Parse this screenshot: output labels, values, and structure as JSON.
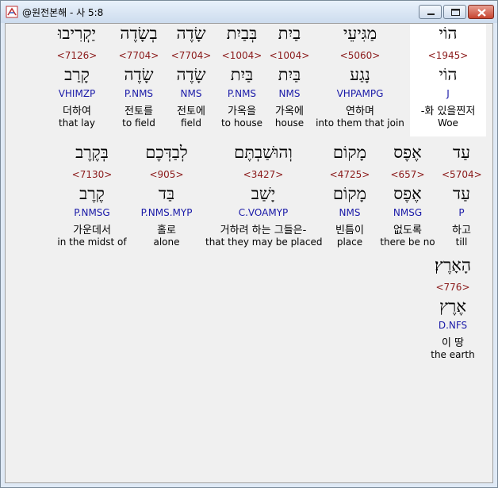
{
  "window": {
    "title": "@원전본해 - 사 5:8"
  },
  "words": [
    {
      "heb": "הוֹי",
      "strong": "<1945>",
      "lemma": "הוֹי",
      "parse": "J",
      "kor": "-화 있을찐저",
      "eng": "Woe",
      "highlight": true
    },
    {
      "heb": "מַגִּיעֵי",
      "strong": "<5060>",
      "lemma": "נָגַע",
      "parse": "VHPAMPG",
      "kor": "연하며",
      "eng": "into them that join"
    },
    {
      "heb": "בַיִת",
      "strong": "<1004>",
      "lemma": "בַּיִת",
      "parse": "NMS",
      "kor": "가옥에",
      "eng": "house"
    },
    {
      "heb": "בְּבַיִת",
      "strong": "<1004>",
      "lemma": "בַּיִת",
      "parse": "P.NMS",
      "kor": "가옥을",
      "eng": "to house"
    },
    {
      "heb": "שָׂדֶה",
      "strong": "<7704>",
      "lemma": "שָׂדֶה",
      "parse": "NMS",
      "kor": "전토에",
      "eng": "field"
    },
    {
      "heb": "בְשָׂדֶה",
      "strong": "<7704>",
      "lemma": "שָׂדֶה",
      "parse": "P.NMS",
      "kor": "전토를",
      "eng": "to field"
    },
    {
      "heb": "יַקְרִיבוּ",
      "strong": "<7126>",
      "lemma": "קָרַב",
      "parse": "VHIMZP",
      "kor": "더하여",
      "eng": "that lay"
    },
    {
      "heb": "עַד",
      "strong": "<5704>",
      "lemma": "עַד",
      "parse": "P",
      "kor": "하고",
      "eng": "till"
    },
    {
      "heb": "אֶפֶס",
      "strong": "<657>",
      "lemma": "אֶפֶס",
      "parse": "NMSG",
      "kor": "없도록",
      "eng": "there be no"
    },
    {
      "heb": "מָקוֹם",
      "strong": "<4725>",
      "lemma": "מָקוֹם",
      "parse": "NMS",
      "kor": "빈틈이",
      "eng": "place"
    },
    {
      "heb": "וְהוּשַׁבְתֶּם",
      "strong": "<3427>",
      "lemma": "יָשַׁב",
      "parse": "C.VOAMYP",
      "kor": "거하려 하는 그들은-",
      "eng": "that they may be placed"
    },
    {
      "heb": "לְבַדְּכֶם",
      "strong": "<905>",
      "lemma": "בַּד",
      "parse": "P.NMS.MYP",
      "kor": "홀로",
      "eng": "alone"
    },
    {
      "heb": "בְּקֶרֶב",
      "strong": "<7130>",
      "lemma": "קֶרֶב",
      "parse": "P.NMSG",
      "kor": "가운데서",
      "eng": "in the midst of"
    },
    {
      "heb": "הָאָרֶץ׃",
      "strong": "<776>",
      "lemma": "אֶרֶץ",
      "parse": "D.NFS",
      "kor": "이 땅",
      "eng": "the earth"
    }
  ]
}
